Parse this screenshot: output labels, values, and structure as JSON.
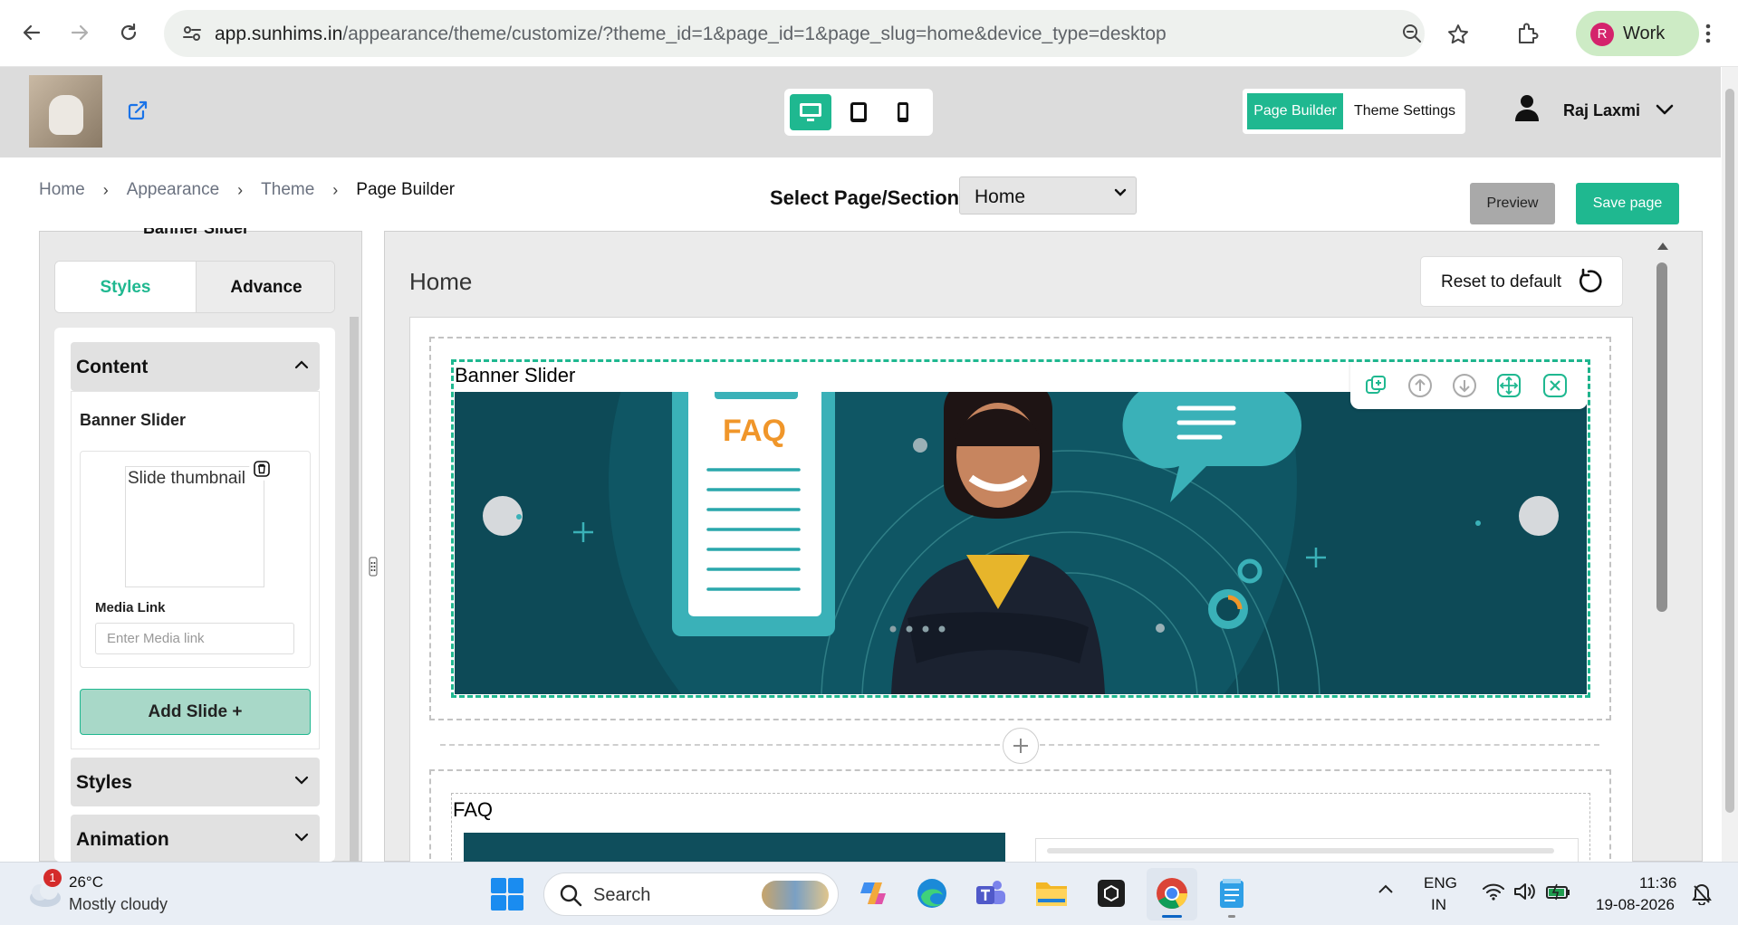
{
  "browser": {
    "url_domain": "app.sunhims.in",
    "url_path": "/appearance/theme/customize/?theme_id=1&page_id=1&page_slug=home&device_type=desktop",
    "profile_initial": "R",
    "profile_name": "Work"
  },
  "header": {
    "mode_page_builder": "Page Builder",
    "mode_theme_settings": "Theme Settings",
    "user_name": "Raj Laxmi",
    "devices": [
      "desktop-icon",
      "tablet-icon",
      "mobile-icon"
    ],
    "active_device": "desktop"
  },
  "breadcrumb": [
    "Home",
    "Appearance",
    "Theme",
    "Page Builder"
  ],
  "page_select": {
    "label": "Select Page/Section:",
    "value": "Home"
  },
  "actions": {
    "preview": "Preview",
    "save": "Save page"
  },
  "left_panel": {
    "cut_title": "Banner Slider",
    "tabs": [
      "Styles",
      "Advance"
    ],
    "active_tab": "Styles",
    "content_header": "Content",
    "content_section_label": "Banner Slider",
    "slide_thumb_alt": "Slide thumbnail",
    "media_link_label": "Media Link",
    "media_link_placeholder": "Enter Media link",
    "add_slide": "Add Slide +",
    "styles_header": "Styles",
    "animation_header": "Animation"
  },
  "canvas": {
    "page_title": "Home",
    "reset_label": "Reset to default",
    "section1_title": "Banner Slider",
    "banner_text": "FAQ",
    "section2_title": "FAQ"
  },
  "taskbar": {
    "weather_badge": "1",
    "temperature": "26°C",
    "condition": "Mostly cloudy",
    "search_placeholder": "Search",
    "lang_top": "ENG",
    "lang_bottom": "IN",
    "time": "11:36",
    "date": "19-08-2026"
  },
  "colors": {
    "accent": "#1fb890",
    "banner_bg": "#0f4e5c",
    "faq_orange": "#f0962a"
  }
}
